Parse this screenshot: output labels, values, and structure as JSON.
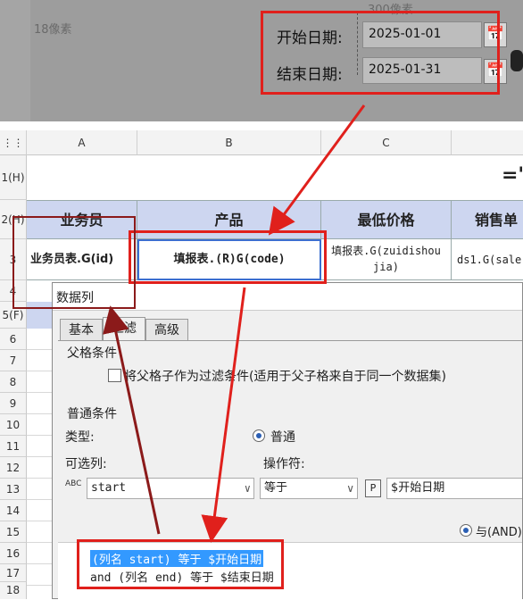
{
  "top": {
    "height_label": "18像素",
    "width_label": "300像素",
    "start_label": "开始日期:",
    "start_value": "2025-01-01",
    "end_label": "结束日期:",
    "end_value": "2025-01-31"
  },
  "sheet": {
    "columns": [
      "A",
      "B",
      "C"
    ],
    "rows": [
      "1(H)",
      "2(H)",
      "3",
      "4",
      "5(F)",
      "6",
      "7",
      "8",
      "9",
      "10",
      "11",
      "12",
      "13",
      "14",
      "15",
      "16",
      "17",
      "18"
    ],
    "title_fragment": "=\"",
    "headers": [
      "业务员",
      "产品",
      "最低价格",
      "销售单"
    ],
    "data": [
      "业务员表.G(id)",
      "填报表.(R)G(code)",
      "填报表.G(zuidishoujia)",
      "ds1.G(sale"
    ]
  },
  "dialog": {
    "title": "数据列",
    "tabs": [
      "基本",
      "过滤",
      "高级"
    ],
    "parent_section": "父格条件",
    "parent_checkbox": "将父格子作为过滤条件(适用于父子格来自于同一个数据集)",
    "normal_section": "普通条件",
    "type_label": "类型:",
    "radio_normal": "普通",
    "optional_col_label": "可选列:",
    "operator_label": "操作符:",
    "column_value": "start",
    "operator_value": "等于",
    "param_value": "$开始日期",
    "and_label": "与(AND)",
    "conditions": [
      "(列名 start) 等于 $开始日期",
      "and (列名 end) 等于 $结束日期"
    ],
    "icons": {
      "abc": "abc-icon",
      "param": "P"
    }
  },
  "colors": {
    "red": "#e0201c",
    "header_fill": "#cdd6f0",
    "selection": "#3399ff"
  }
}
